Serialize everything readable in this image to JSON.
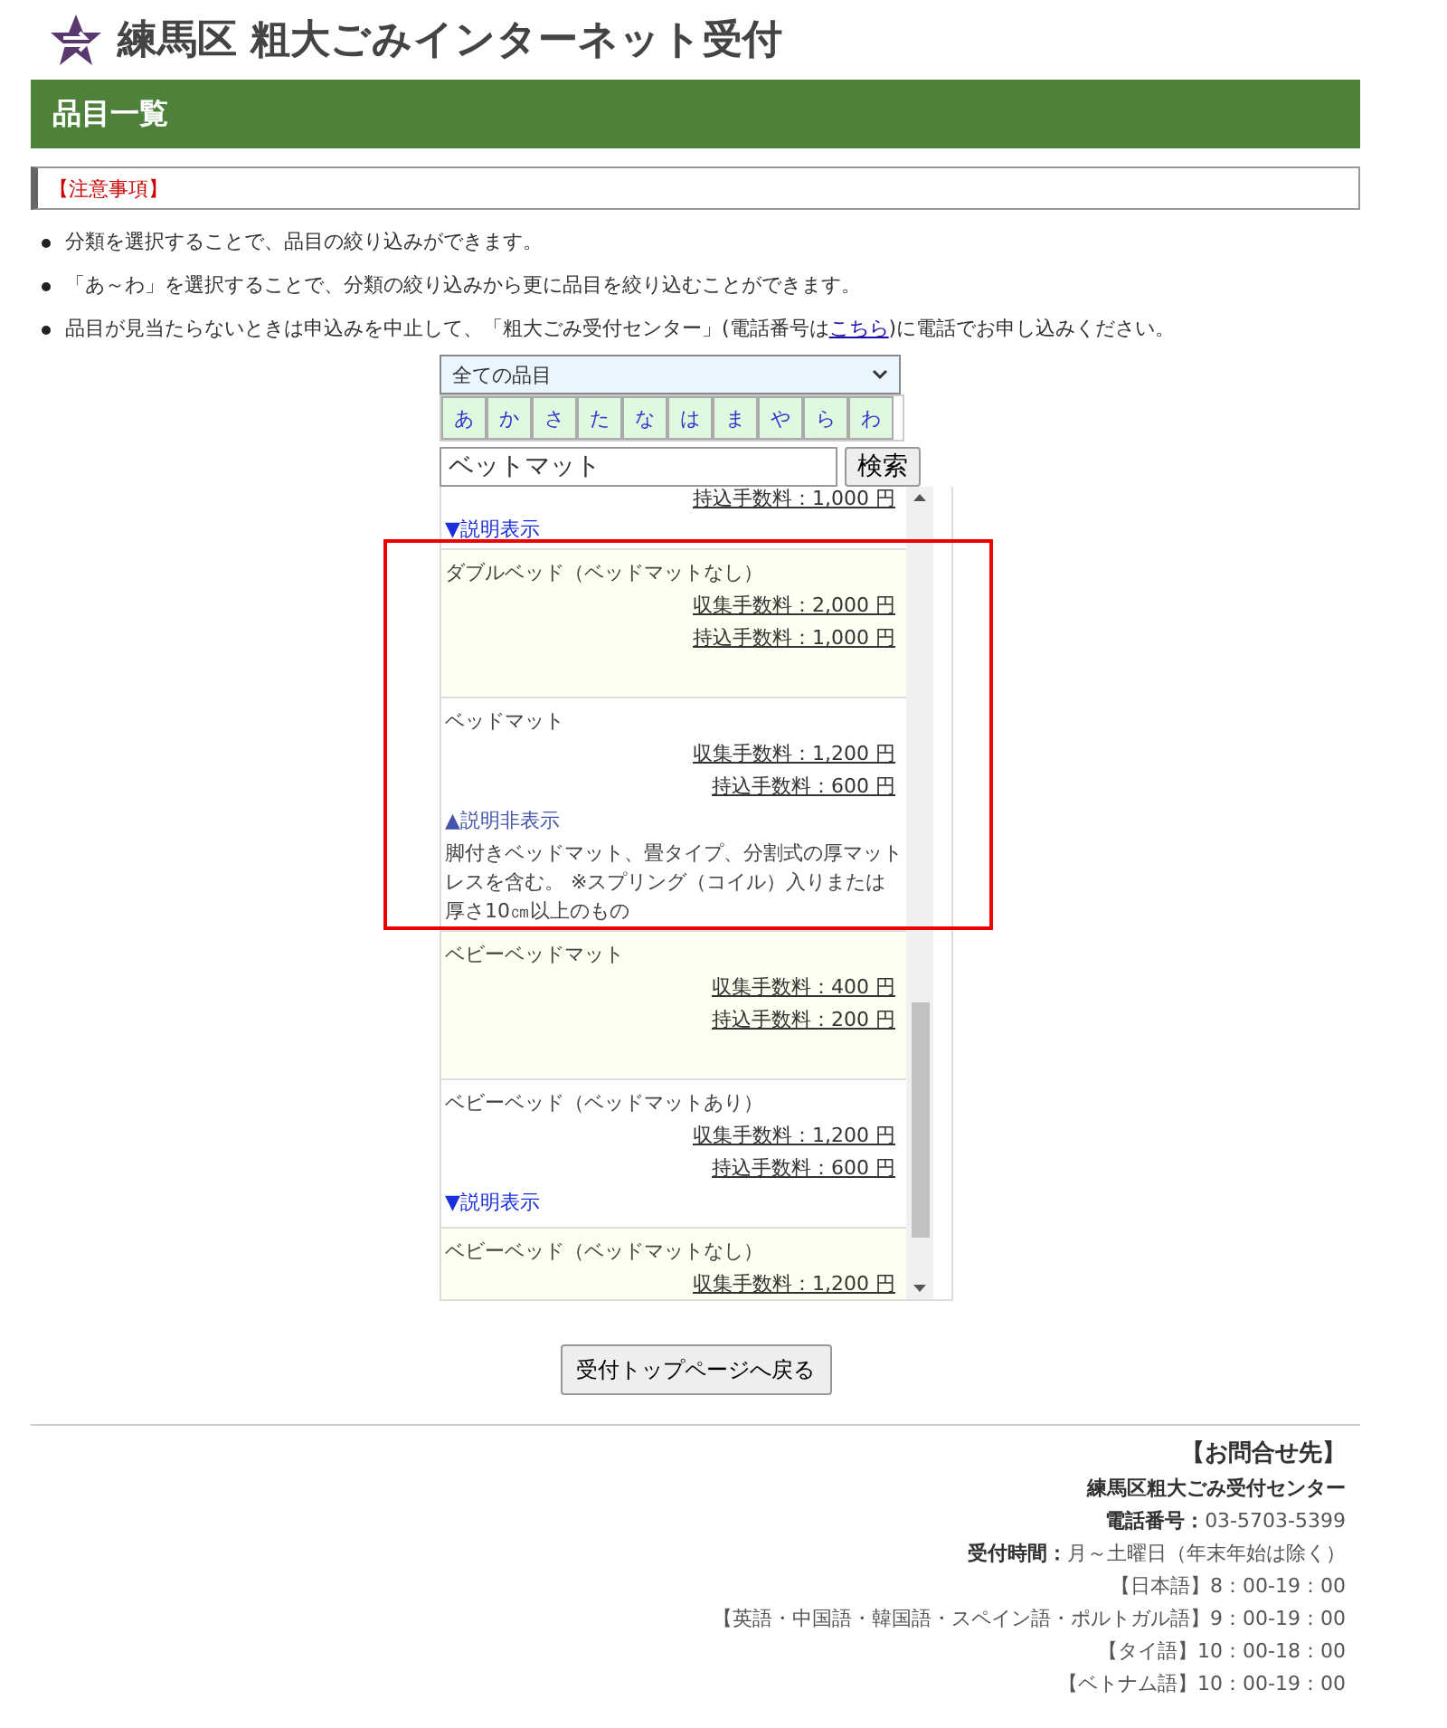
{
  "header": {
    "title": "練馬区 粗大ごみインターネット受付"
  },
  "section_title": "品目一覧",
  "notice": {
    "title": "【注意事項】"
  },
  "notes": [
    {
      "text": "分類を選択することで、品目の絞り込みができます。"
    },
    {
      "text": "「あ～わ」を選択することで、分類の絞り込みから更に品目を絞り込むことができます。"
    },
    {
      "text": "品目が見当たらないときは申込みを中止して、「粗大ごみ受付センター」(電話番号は",
      "link": "こちら",
      "after": ")に電話でお申し込みください。"
    }
  ],
  "category_select": {
    "value": "全ての品目"
  },
  "kana_tabs": [
    {
      "label": "あ",
      "selected": false
    },
    {
      "label": "か",
      "selected": false
    },
    {
      "label": "さ",
      "selected": false
    },
    {
      "label": "た",
      "selected": false
    },
    {
      "label": "な",
      "selected": false
    },
    {
      "label": "は",
      "selected": false
    },
    {
      "label": "ま",
      "selected": false
    },
    {
      "label": "や",
      "selected": false
    },
    {
      "label": "ら",
      "selected": false
    },
    {
      "label": "わ",
      "selected": false
    }
  ],
  "search": {
    "value": "ベットマット",
    "button": "検索"
  },
  "items": [
    {
      "fees": [
        "持込手数料：1,000 円"
      ],
      "toggle": {
        "label": "▼説明表示",
        "expanded": false
      }
    },
    {
      "name": "ダブルベッド（ベッドマットなし）",
      "fees": [
        "収集手数料：2,000 円",
        "持込手数料：1,000 円"
      ]
    },
    {
      "name": "ベッドマット",
      "fees": [
        "収集手数料：1,200 円",
        "持込手数料：600 円"
      ],
      "toggle": {
        "label": "▲説明非表示",
        "expanded": true,
        "text": "脚付きベッドマット、畳タイプ、分割式の厚マットレスを含む。 ※スプリング（コイル）入りまたは厚さ10㎝以上のもの"
      }
    },
    {
      "name": "ベビーベッドマット",
      "fees": [
        "収集手数料：400 円",
        "持込手数料：200 円"
      ]
    },
    {
      "name": "ベビーベッド（ベッドマットあり）",
      "fees": [
        "収集手数料：1,200 円",
        "持込手数料：600 円"
      ],
      "toggle": {
        "label": "▼説明表示",
        "expanded": false
      }
    },
    {
      "name": "ベビーベッド（ベッドマットなし）",
      "fees": [
        "収集手数料：1,200 円"
      ]
    }
  ],
  "back_button": "受付トップページへ戻る",
  "contact": {
    "title": "【お問合せ先】",
    "lines": [
      "**練馬区粗大ごみ受付センター**",
      "**電話番号：**03-5703-5399",
      "**受付時間：**月～土曜日（年末年始は除く）",
      "【日本語】8：00-19：00",
      "【英語・中国語・韓国語・スペイン語・ポルトガル語】9：00-19：00",
      "【タイ語】10：00-18：00",
      "【ベトナム語】10：00-19：00"
    ]
  }
}
